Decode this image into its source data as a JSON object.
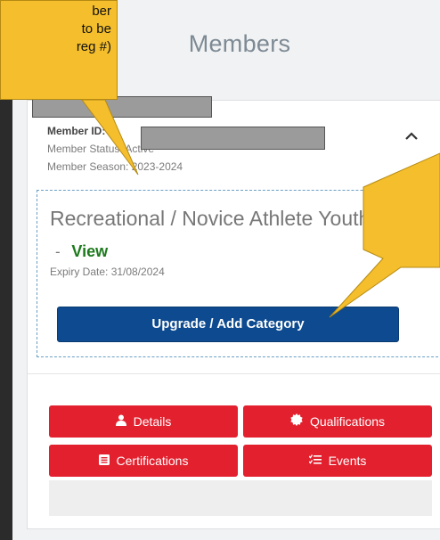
{
  "page": {
    "title": "Members"
  },
  "member": {
    "id_label": "Member ID: 1",
    "status_label": "Member Status: Active",
    "season_label": "Member Season: 2023-2024"
  },
  "category": {
    "name": "Recreational / Novice Athlete Youth",
    "dash": "-",
    "view_label": "View",
    "expiry": "Expiry Date: 31/08/2024",
    "upgrade_label": "Upgrade / Add Category"
  },
  "actions": {
    "details": "Details",
    "qualifications": "Qualifications",
    "certifications": "Certifications",
    "events": "Events"
  },
  "annotation": {
    "lines": [
      "ber",
      "to be",
      "reg #)"
    ]
  },
  "icons": {
    "details": "user-icon",
    "qualifications": "badge-icon",
    "certifications": "certificate-icon",
    "events": "list-icon",
    "collapse": "chevron-up-icon"
  },
  "colors": {
    "primary_button": "#0d4a8f",
    "danger_button": "#e2202e",
    "view_link": "#1d7a1d",
    "callout": "#f4be2c"
  }
}
